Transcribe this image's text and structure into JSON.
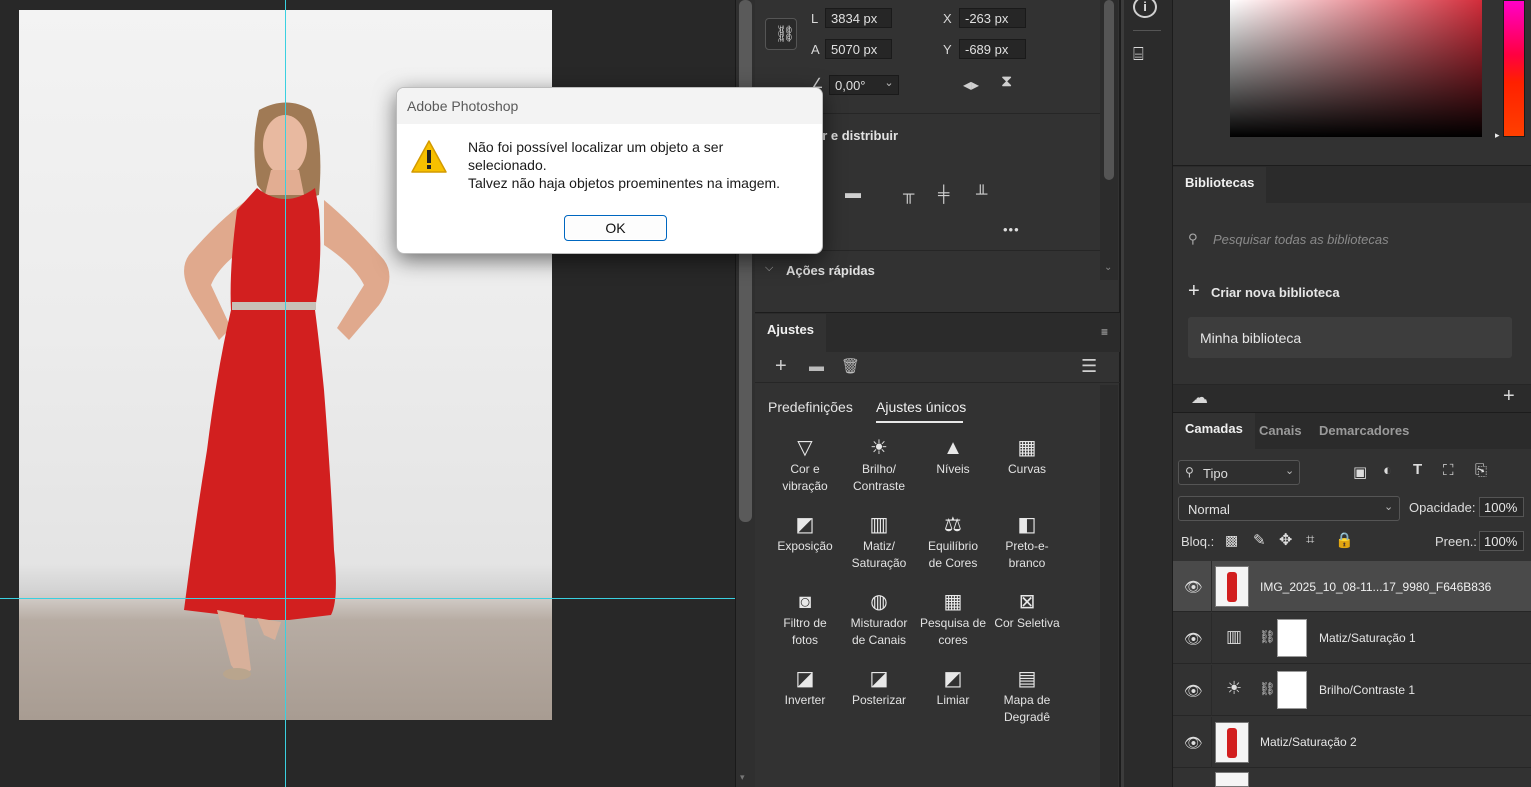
{
  "properties": {
    "w_label": "L",
    "w_value": "3834 px",
    "h_label": "A",
    "h_value": "5070 px",
    "x_label": "X",
    "x_value": "-263 px",
    "y_label": "Y",
    "y_value": "-689 px",
    "angle_value": "0,00°",
    "align_section": "ar e distribuir",
    "more": "•••",
    "quick_actions": "Ações rápidas"
  },
  "adjustments": {
    "title": "Ajustes",
    "tab_presets": "Predefinições",
    "tab_single": "Ajustes únicos",
    "items": [
      {
        "icon": "vibrance-icon",
        "glyph": "▽",
        "line1": "Cor e",
        "line2": "vibração"
      },
      {
        "icon": "brightness-icon",
        "glyph": "☀",
        "line1": "Brilho/",
        "line2": "Contraste"
      },
      {
        "icon": "levels-icon",
        "glyph": "▲",
        "line1": "Níveis",
        "line2": ""
      },
      {
        "icon": "curves-icon",
        "glyph": "▦",
        "line1": "Curvas",
        "line2": ""
      },
      {
        "icon": "exposure-icon",
        "glyph": "◩",
        "line1": "Exposição",
        "line2": ""
      },
      {
        "icon": "hue-saturation-icon",
        "glyph": "▥",
        "line1": "Matiz/",
        "line2": "Saturação"
      },
      {
        "icon": "color-balance-icon",
        "glyph": "⚖",
        "line1": "Equilíbrio",
        "line2": "de Cores"
      },
      {
        "icon": "black-white-icon",
        "glyph": "◧",
        "line1": "Preto-e-",
        "line2": "branco"
      },
      {
        "icon": "photo-filter-icon",
        "glyph": "◙",
        "line1": "Filtro de",
        "line2": "fotos"
      },
      {
        "icon": "channel-mixer-icon",
        "glyph": "◍",
        "line1": "Misturador",
        "line2": "de Canais"
      },
      {
        "icon": "color-lookup-icon",
        "glyph": "▦",
        "line1": "Pesquisa de",
        "line2": "cores"
      },
      {
        "icon": "selective-color-icon",
        "glyph": "⊠",
        "line1": "Cor Seletiva",
        "line2": ""
      },
      {
        "icon": "invert-icon",
        "glyph": "◪",
        "line1": "Inverter",
        "line2": ""
      },
      {
        "icon": "posterize-icon",
        "glyph": "◪",
        "line1": "Posterizar",
        "line2": ""
      },
      {
        "icon": "threshold-icon",
        "glyph": "◩",
        "line1": "Limiar",
        "line2": ""
      },
      {
        "icon": "gradient-map-icon",
        "glyph": "▤",
        "line1": "Mapa de",
        "line2": "Degradê"
      }
    ]
  },
  "libraries": {
    "title": "Bibliotecas",
    "search_placeholder": "Pesquisar todas as bibliotecas",
    "create": "Criar nova biblioteca",
    "my_library": "Minha biblioteca"
  },
  "layers": {
    "tabs": [
      "Camadas",
      "Canais",
      "Demarcadores"
    ],
    "filter_label": "Tipo",
    "blend_mode": "Normal",
    "opacity_label": "Opacidade:",
    "opacity_value": "100%",
    "lock_label": "Bloq.:",
    "fill_label": "Preen.:",
    "fill_value": "100%",
    "rows": [
      {
        "name": "IMG_2025_10_08-11...17_9980_F646B836",
        "type": "image"
      },
      {
        "name": "Matiz/Saturação 1",
        "type": "adjustment"
      },
      {
        "name": "Brilho/Contraste 1",
        "type": "adjustment"
      },
      {
        "name": "Matiz/Saturação 2",
        "type": "image"
      }
    ]
  },
  "dialog": {
    "title": "Adobe Photoshop",
    "message_line1": "Não foi possível localizar um objeto a ser",
    "message_line2": "selecionado.",
    "message_line3": "Talvez não haja objetos proeminentes na imagem.",
    "ok": "OK"
  },
  "colors": {
    "guide": "#3ad0e0",
    "dress": "#d21f1f",
    "dialog_accent": "#0067c0"
  }
}
